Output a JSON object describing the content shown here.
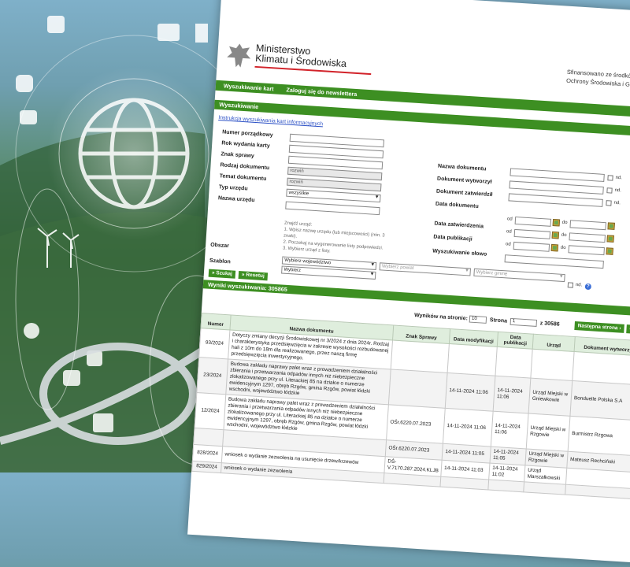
{
  "page": {
    "ministry_line1": "Ministerstwo",
    "ministry_line2": "Klimatu i Środowiska",
    "funding_line1": "Sfinansowano ze środków Narodowego",
    "funding_line2": "Ochrony Środowiska i Gospodarki Wodn"
  },
  "nav": {
    "search_cards": "Wyszukiwanie kart",
    "newsletter": "Zaloguj się do newslettera"
  },
  "search": {
    "title": "Wyszukiwanie",
    "instructions_link": "Instrukcja wyszukiwania kart informacyjnych",
    "labels": {
      "number": "Numer porządkowy",
      "year": "Rok wydania karty",
      "case": "Znak sprawy",
      "doc_type": "Rodzaj dokumentu",
      "doc_subject": "Temat dokumentu",
      "office_type": "Typ urzędu",
      "office_name": "Nazwa urzędu",
      "area": "Obszar",
      "template": "Szablon",
      "doc_name": "Nazwa dokumentu",
      "doc_issued": "Dokument wytworzył",
      "doc_approved": "Dokument zatwierdził",
      "doc_date": "Data dokumentu",
      "approval_date": "Data zatwierdzenia",
      "publication_date": "Data publikacji",
      "keyword": "Wyszukiwanie słowo"
    },
    "values": {
      "doc_type": "rozwiń",
      "doc_subject": "rozwiń",
      "office_type": "wszystkie",
      "voivodeship": "Wybierz województwo",
      "district": "Wybierz powiat",
      "commune": "Wybierz gminę",
      "template": "Wybierz"
    },
    "hint_lines": [
      "Znajdź urząd:",
      "1. Wpisz nazwę urzędu (lub miejscowości) (min. 3 znaki).",
      "2. Poczekaj na wygenerowanie listy podpowiedzi.",
      "3. Wybierz urząd z listy."
    ],
    "nd": "nd.",
    "od": "od",
    "do": "do",
    "search_btn": "» Szukaj",
    "reset_btn": "» Resetuj"
  },
  "results": {
    "title": "Wyniki wyszukiwania: 305865",
    "per_page_label": "Wyników na stronie:",
    "per_page_value": "10",
    "page_label": "Strona",
    "page_value": "1",
    "page_total": "z 30586",
    "next_btn": "Następna strona ›",
    "last_btn": "Os",
    "columns": [
      "Numer",
      "Nazwa dokumentu",
      "Znak Sprawy",
      "Data modyfikacji",
      "Data publikacji",
      "Urząd",
      "Dokument wytworzył"
    ],
    "rows": [
      {
        "num": "93/2024",
        "name": "Dotyczy zmiany decyzji Środowiskowej nr 3/2024 z dnia 2024r. Rodzaj i charakterystyka przedsięwzięcia w zakresie wysokości rozbudowanej hali z 10m do 18m dla realizowanego, przez naszą firmę przedsięwzięcia inwestycyjnego.",
        "sign": "",
        "mod": "",
        "pub": "",
        "office": "",
        "author": ""
      },
      {
        "num": "23/2024",
        "name": "Budowa zakładu naprawy palet wraz z prowadzeniem działalności zbierania i przetwarzania odpadów innych niż niebezpieczne zlokalizowanego przy ul. Literackiej 85 na działce o numerze ewidencyjnym 1297, obręb Rzgów, gmina Rzgów, powiat łódzki wschodni, województwo łódzkie",
        "sign": "",
        "mod": "14-11-2024 11:06",
        "pub": "14-11-2024 11:06",
        "office": "Urząd Miejski w Gniewkowie",
        "author": "Bonduelle Polska S.A"
      },
      {
        "num": "12/2024",
        "name": "Budowa zakładu naprawy palet wraz z prowadzeniem działalności zbierania i przetwarzania odpadów innych niż niebezpieczne zlokalizowanego przy ul. Literackiej 85 na działce o numerze ewidencyjnym 1297, obręb Rzgów, gmina Rzgów, powiat łódzki wschodni, województwo łódzkie",
        "sign": "OŚr.6220.07.2023",
        "mod": "14-11-2024 11:06",
        "pub": "14-11-2024 11:06",
        "office": "Urząd Miejski w Rzgowie",
        "author": "Burmistrz Rzgowa"
      },
      {
        "num": "",
        "name": "",
        "sign": "OŚr.6220.07.2023",
        "mod": "14-11-2024 11:05",
        "pub": "14-11-2024 11:05",
        "office": "Urząd Miejski w Rzgowie",
        "author": "Mateusz Rechciński"
      },
      {
        "num": "828/2024",
        "name": "wniosek o wydanie zezwolenia na usunięcie drzew/krzewów",
        "sign": "DŚ-V.7170.287.2024.KLJB",
        "mod": "14-11-2024 11:03",
        "pub": "14-11-2024 11:02",
        "office": "Urząd Marszałkowski",
        "author": ""
      },
      {
        "num": "829/2024",
        "name": "wniosek o wydanie zezwolenia",
        "sign": "",
        "mod": "",
        "pub": "",
        "office": "",
        "author": ""
      }
    ]
  }
}
